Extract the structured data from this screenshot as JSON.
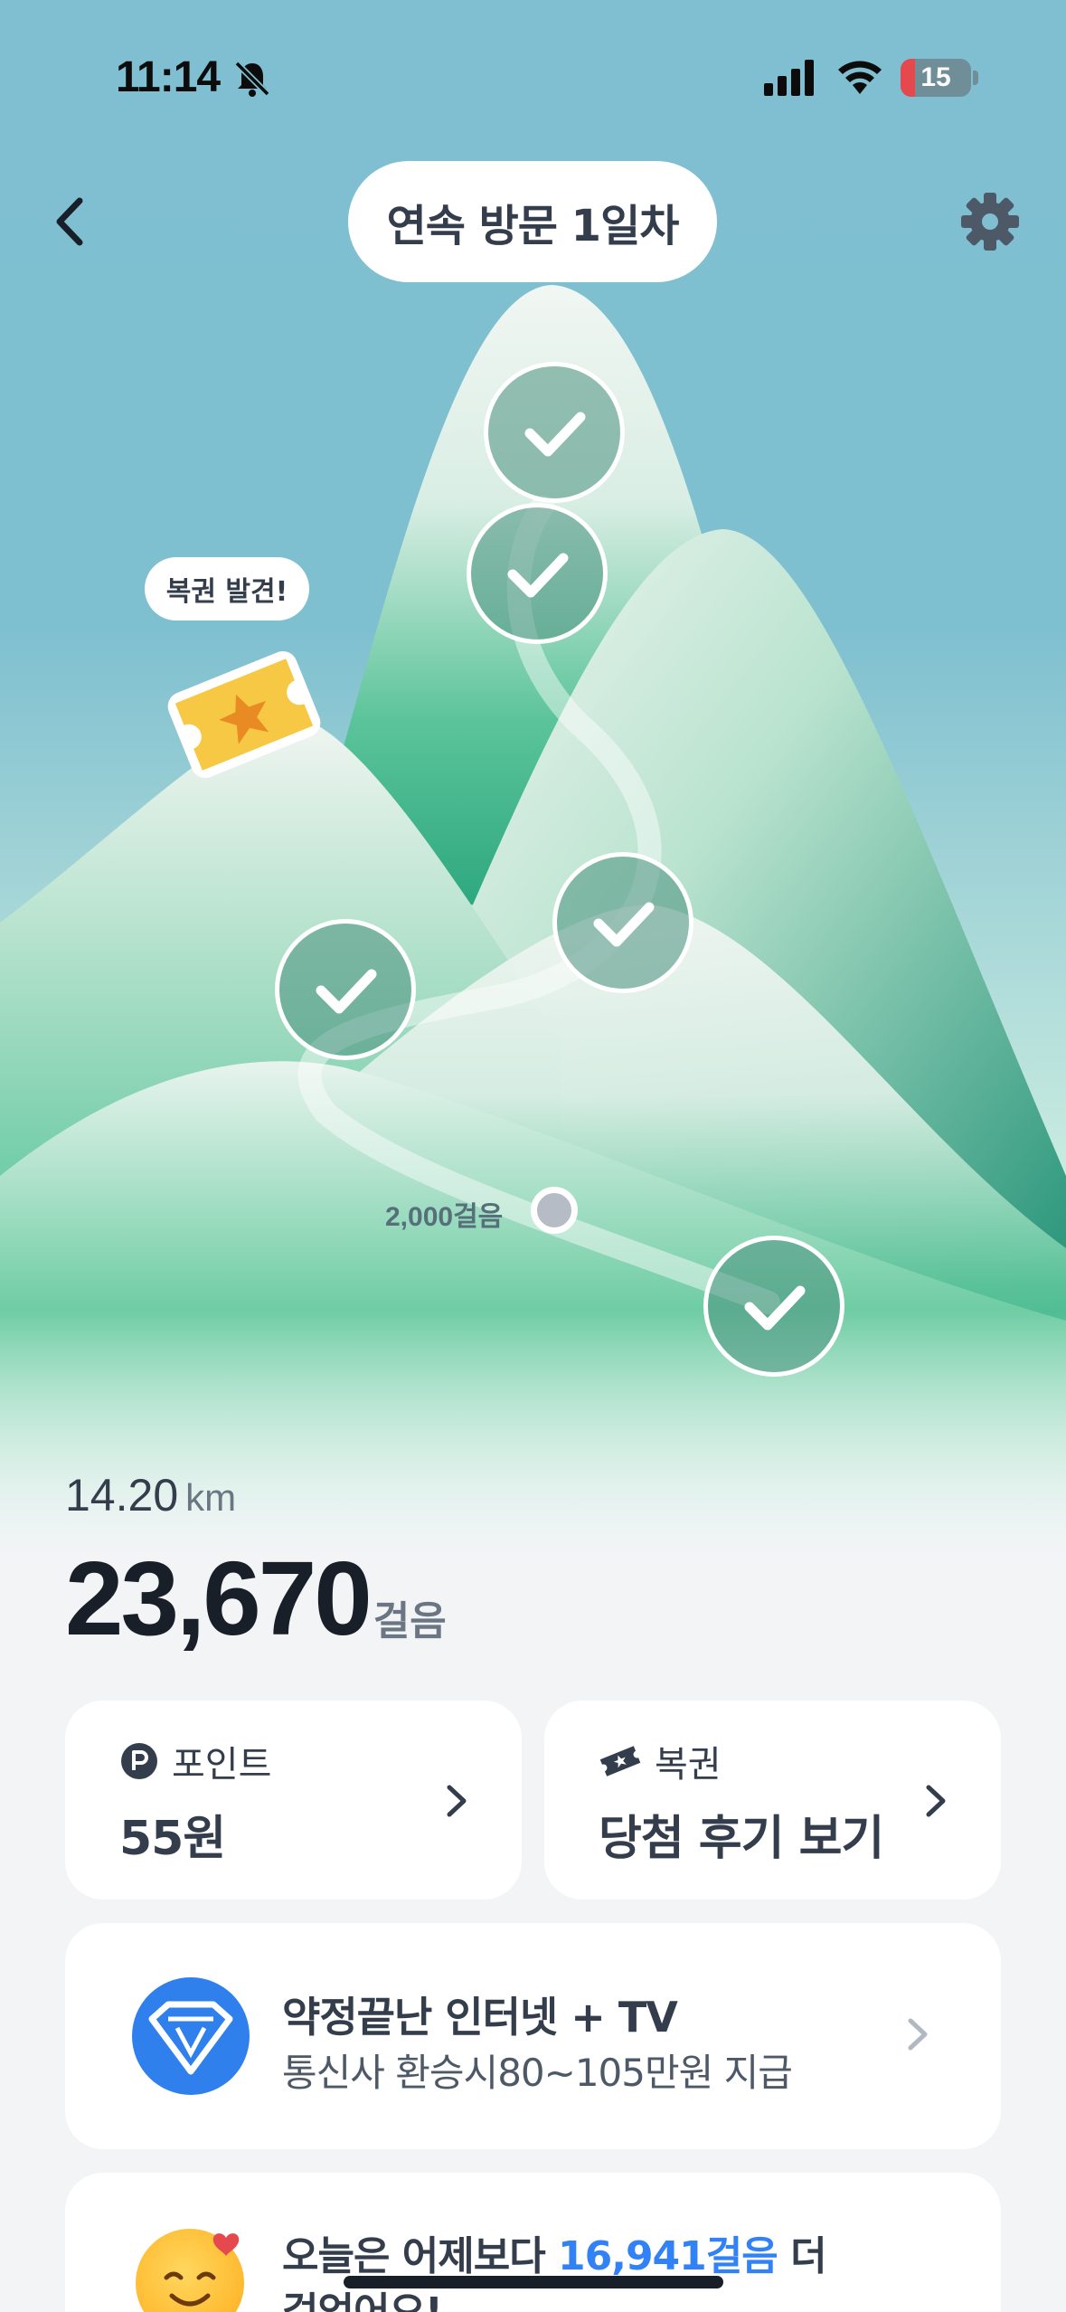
{
  "status_bar": {
    "time": "11:14",
    "battery": "15"
  },
  "nav": {
    "title": "연속 방문 1일차"
  },
  "map": {
    "lottery_bubble": "복권 발견!",
    "goal_label": "2,000걸음",
    "checkpoints_completed": 5
  },
  "stats": {
    "distance_value": "14.20",
    "distance_unit": "km",
    "steps_value": "23,670",
    "steps_unit": "걸음"
  },
  "cards": {
    "points": {
      "label": "포인트",
      "value": "55원"
    },
    "lottery": {
      "label": "복권",
      "value": "당첨 후기 보기"
    }
  },
  "ad": {
    "title": "약정끝난 인터넷 + TV",
    "subtitle": "통신사 환승시80~105만원 지급"
  },
  "compare": {
    "prefix": "오늘은 어제보다 ",
    "highlight": "16,941걸음",
    "suffix": " 더",
    "line2": "걸었어요!"
  },
  "colors": {
    "sky": "#7fbfd1",
    "mountain_green": "#3fbf8f",
    "accent_blue": "#3182f6"
  }
}
